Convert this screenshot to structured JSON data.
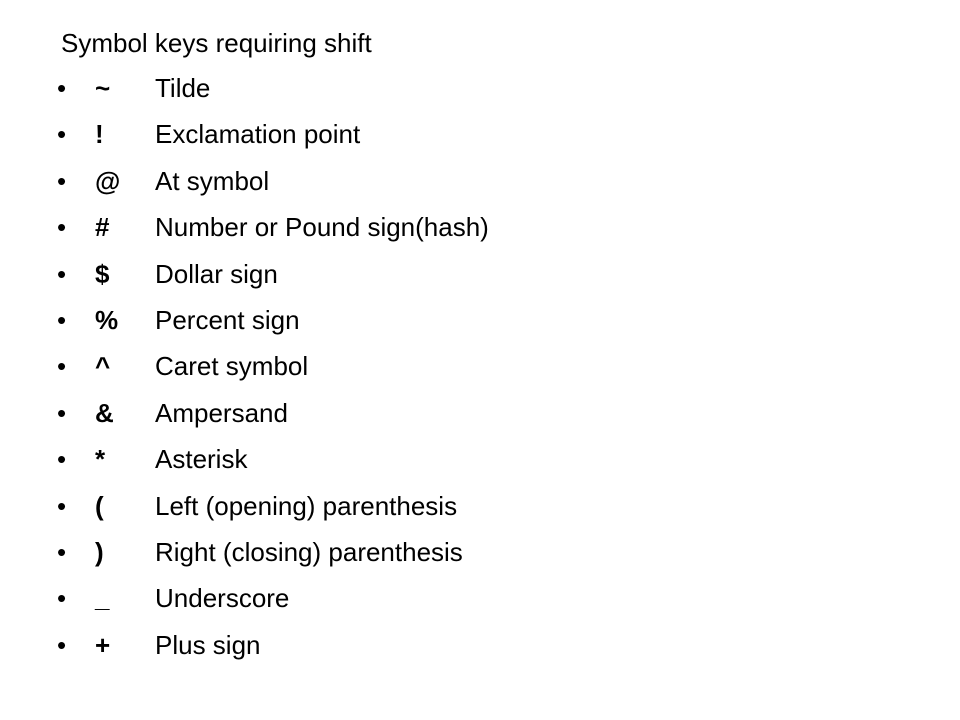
{
  "title": "Symbol keys requiring shift",
  "bullet_glyph": "•",
  "items": [
    {
      "symbol": "~",
      "description": "Tilde"
    },
    {
      "symbol": "!",
      "description": "Exclamation point"
    },
    {
      "symbol": "@",
      "description": "At symbol"
    },
    {
      "symbol": "#",
      "description": "Number or Pound sign(hash)"
    },
    {
      "symbol": "$",
      "description": "Dollar sign"
    },
    {
      "symbol": "%",
      "description": "Percent sign"
    },
    {
      "symbol": "^",
      "description": "Caret symbol"
    },
    {
      "symbol": "&",
      "description": "Ampersand"
    },
    {
      "symbol": "*",
      "description": "Asterisk"
    },
    {
      "symbol": "(",
      "description": "Left (opening) parenthesis"
    },
    {
      "symbol": ")",
      "description": "Right (closing) parenthesis"
    },
    {
      "symbol": "_",
      "description": "Underscore"
    },
    {
      "symbol": "+",
      "description": "Plus sign"
    }
  ]
}
